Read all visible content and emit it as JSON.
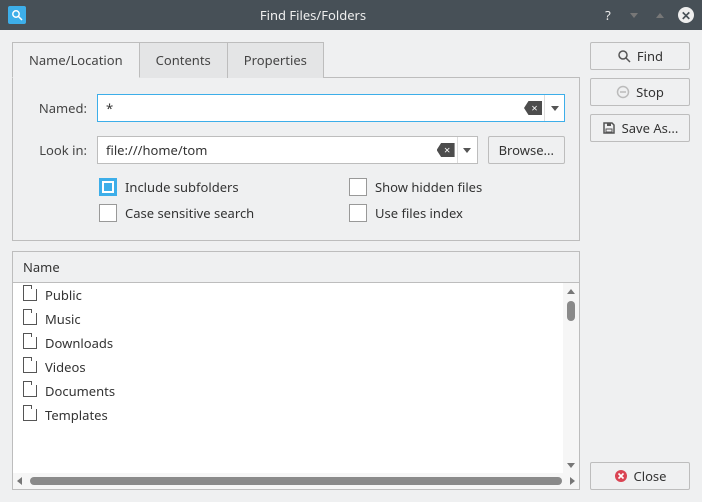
{
  "window": {
    "title": "Find Files/Folders"
  },
  "tabs": [
    {
      "label": "Name/Location",
      "active": true
    },
    {
      "label": "Contents",
      "active": false
    },
    {
      "label": "Properties",
      "active": false
    }
  ],
  "form": {
    "named_label": "Named:",
    "named_value": "*",
    "lookin_label": "Look in:",
    "lookin_value": "file:///home/tom",
    "browse_label": "Browse..."
  },
  "options": {
    "include_subfolders": {
      "label": "Include subfolders",
      "checked": true
    },
    "show_hidden": {
      "label": "Show hidden files",
      "checked": false
    },
    "case_sensitive": {
      "label": "Case sensitive search",
      "checked": false
    },
    "use_index": {
      "label": "Use files index",
      "checked": false
    }
  },
  "results": {
    "columns": [
      "Name"
    ],
    "items": [
      "Public",
      "Music",
      "Downloads",
      "Videos",
      "Documents",
      "Templates"
    ]
  },
  "actions": {
    "find": "Find",
    "stop": "Stop",
    "save_as": "Save As...",
    "close": "Close"
  }
}
